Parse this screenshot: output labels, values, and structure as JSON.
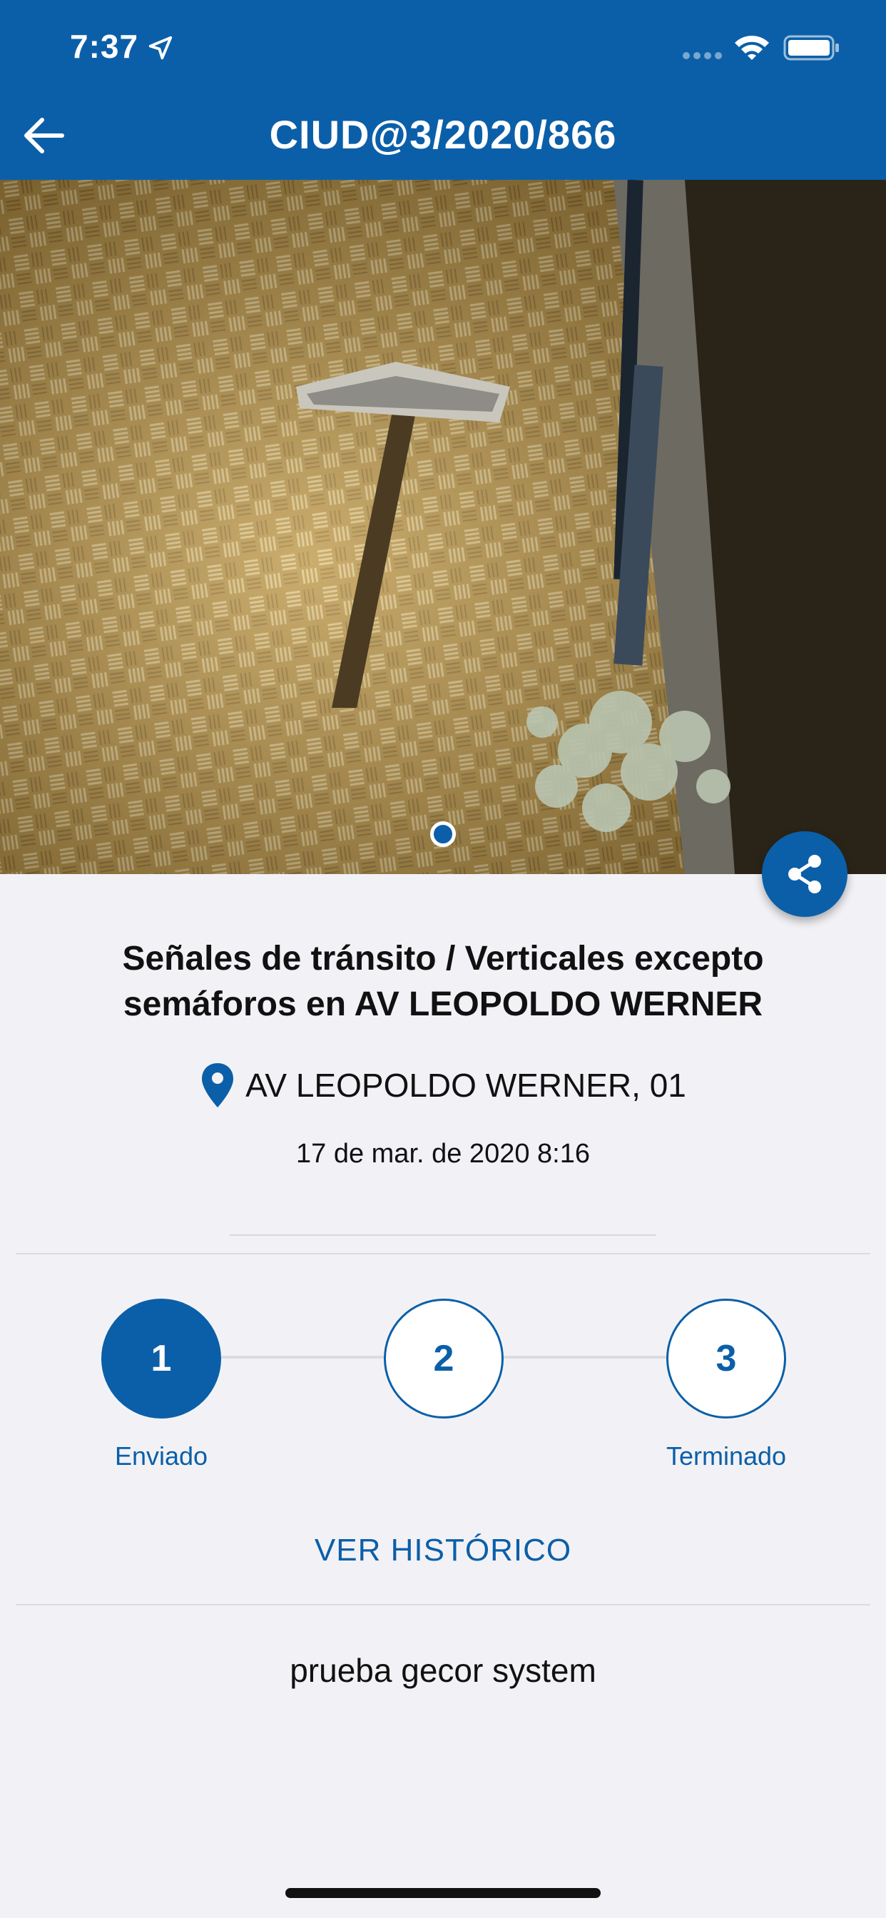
{
  "status_bar": {
    "time": "7:37"
  },
  "nav": {
    "title": "CIUD@3/2020/866"
  },
  "incident": {
    "title": "Señales de tránsito / Verticales excepto semáforos en AV LEOPOLDO WERNER",
    "address": "AV LEOPOLDO WERNER, 01",
    "date": "17 de mar. de 2020 8:16",
    "description": "prueba gecor system"
  },
  "progress": {
    "current_step": 1,
    "steps": [
      {
        "number": "1",
        "label": "Enviado"
      },
      {
        "number": "2",
        "label": ""
      },
      {
        "number": "3",
        "label": "Terminado"
      }
    ]
  },
  "actions": {
    "history_label": "VER HISTÓRICO"
  },
  "colors": {
    "primary": "#0b5fa8",
    "background": "#f2f2f6"
  },
  "icons": [
    "back-arrow-icon",
    "location-arrow-icon",
    "wifi-icon",
    "battery-icon",
    "share-icon",
    "map-pin-icon"
  ]
}
